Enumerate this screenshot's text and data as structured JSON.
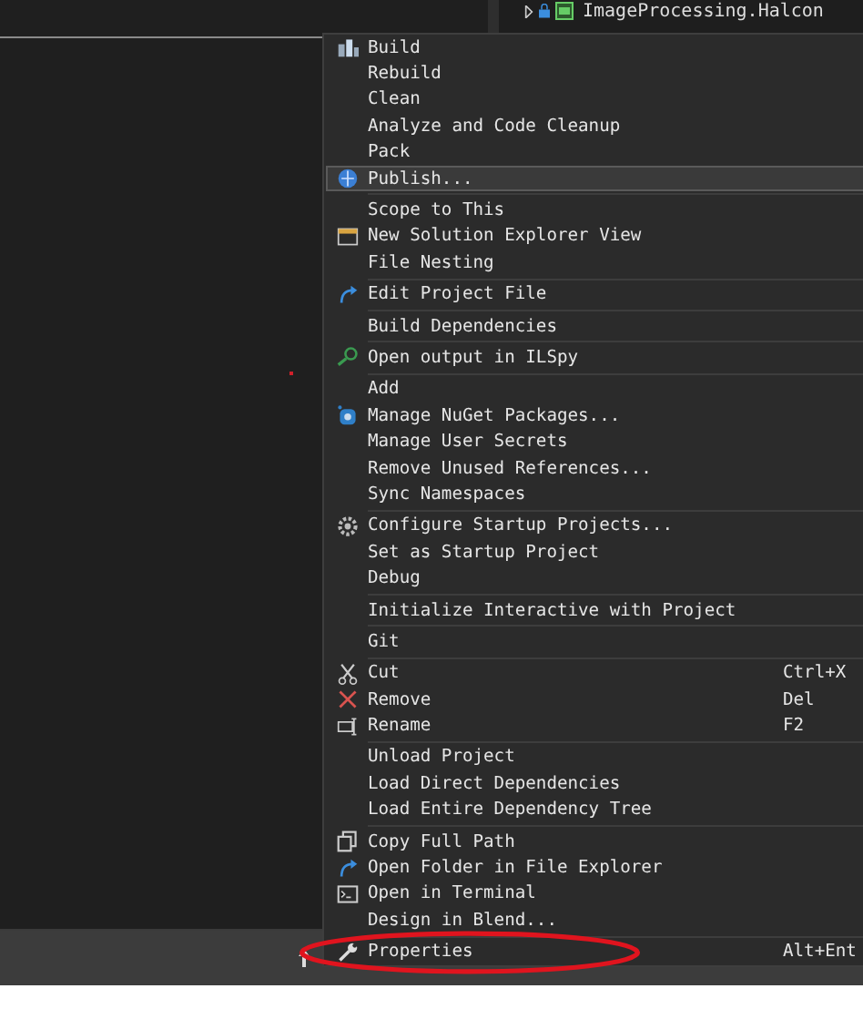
{
  "solution_explorer": {
    "items": [
      {
        "label": "ImageProcessing.Halcon",
        "expanded": false
      }
    ]
  },
  "context_menu": {
    "groups": [
      [
        {
          "label": "Build",
          "kind": "build",
          "selected": false
        },
        {
          "label": "Rebuild",
          "kind": "plain",
          "selected": false
        },
        {
          "label": "Clean",
          "kind": "plain",
          "selected": false
        },
        {
          "label": "Analyze and Code Cleanup",
          "kind": "plain",
          "selected": false
        },
        {
          "label": "Pack",
          "kind": "plain",
          "selected": false
        },
        {
          "label": "Publish...",
          "kind": "publish",
          "selected": true
        }
      ],
      [
        {
          "label": "Scope to This",
          "kind": "plain",
          "selected": false
        },
        {
          "label": "New Solution Explorer View",
          "kind": "explorer",
          "selected": false
        },
        {
          "label": "File Nesting",
          "kind": "plain",
          "selected": false
        }
      ],
      [
        {
          "label": "Edit Project File",
          "kind": "edit",
          "selected": false
        }
      ],
      [
        {
          "label": "Build Dependencies",
          "kind": "plain",
          "selected": false
        }
      ],
      [
        {
          "label": "Open output in ILSpy",
          "kind": "ilspy",
          "selected": false
        }
      ],
      [
        {
          "label": "Add",
          "kind": "plain",
          "selected": false
        },
        {
          "label": "Manage NuGet Packages...",
          "kind": "nuget",
          "selected": false
        },
        {
          "label": "Manage User Secrets",
          "kind": "plain",
          "selected": false
        },
        {
          "label": "Remove Unused References...",
          "kind": "plain",
          "selected": false
        },
        {
          "label": "Sync Namespaces",
          "kind": "plain",
          "selected": false
        }
      ],
      [
        {
          "label": "Configure Startup Projects...",
          "kind": "gear",
          "selected": false
        },
        {
          "label": "Set as Startup Project",
          "kind": "plain",
          "selected": false
        },
        {
          "label": "Debug",
          "kind": "plain",
          "selected": false
        }
      ],
      [
        {
          "label": "Initialize Interactive with Project",
          "kind": "plain",
          "selected": false
        }
      ],
      [
        {
          "label": "Git",
          "kind": "plain",
          "selected": false
        }
      ],
      [
        {
          "label": "Cut",
          "kind": "cut",
          "shortcut": "Ctrl+X",
          "selected": false
        },
        {
          "label": "Remove",
          "kind": "remove",
          "shortcut": "Del",
          "selected": false
        },
        {
          "label": "Rename",
          "kind": "rename",
          "shortcut": "F2",
          "selected": false
        }
      ],
      [
        {
          "label": "Unload Project",
          "kind": "plain",
          "selected": false
        },
        {
          "label": "Load Direct Dependencies",
          "kind": "plain",
          "selected": false
        },
        {
          "label": "Load Entire Dependency Tree",
          "kind": "plain",
          "selected": false
        }
      ],
      [
        {
          "label": "Copy Full Path",
          "kind": "copy",
          "selected": false
        },
        {
          "label": "Open Folder in File Explorer",
          "kind": "edit",
          "selected": false
        },
        {
          "label": "Open in Terminal",
          "kind": "terminal",
          "selected": false
        },
        {
          "label": "Design in Blend...",
          "kind": "plain",
          "selected": false
        }
      ],
      [
        {
          "label": "Properties",
          "kind": "wrench",
          "shortcut": "Alt+Ent",
          "selected": false,
          "circled": true
        }
      ]
    ]
  }
}
